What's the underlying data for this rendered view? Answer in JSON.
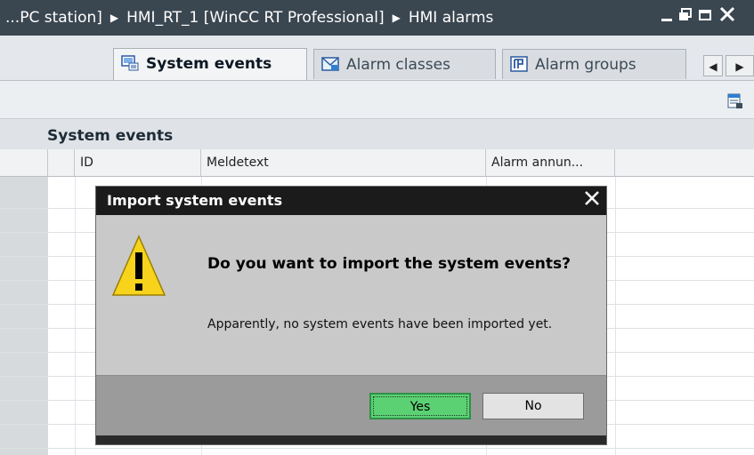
{
  "window": {
    "breadcrumb": [
      "...PC station]",
      "HMI_RT_1 [WinCC RT Professional]",
      "HMI alarms"
    ],
    "controls": [
      "minimize",
      "restore",
      "maximize",
      "close"
    ]
  },
  "tabs": [
    {
      "label": "System events",
      "icon": "system-events-icon",
      "active": true
    },
    {
      "label": "Alarm classes",
      "icon": "alarm-classes-icon",
      "active": false
    },
    {
      "label": "Alarm groups",
      "icon": "alarm-groups-icon",
      "active": false
    }
  ],
  "section": {
    "title": "System events"
  },
  "table": {
    "columns": [
      "ID",
      "Meldetext",
      "Alarm annun..."
    ]
  },
  "dialog": {
    "title": "Import system events",
    "question": "Do you want to import the system events?",
    "detail": "Apparently, no system events have been imported yet.",
    "yes_label": "Yes",
    "no_label": "No"
  },
  "colors": {
    "titlebar": "#3a4650",
    "yes_button": "#5cd174",
    "warning": "#f7d31c"
  }
}
